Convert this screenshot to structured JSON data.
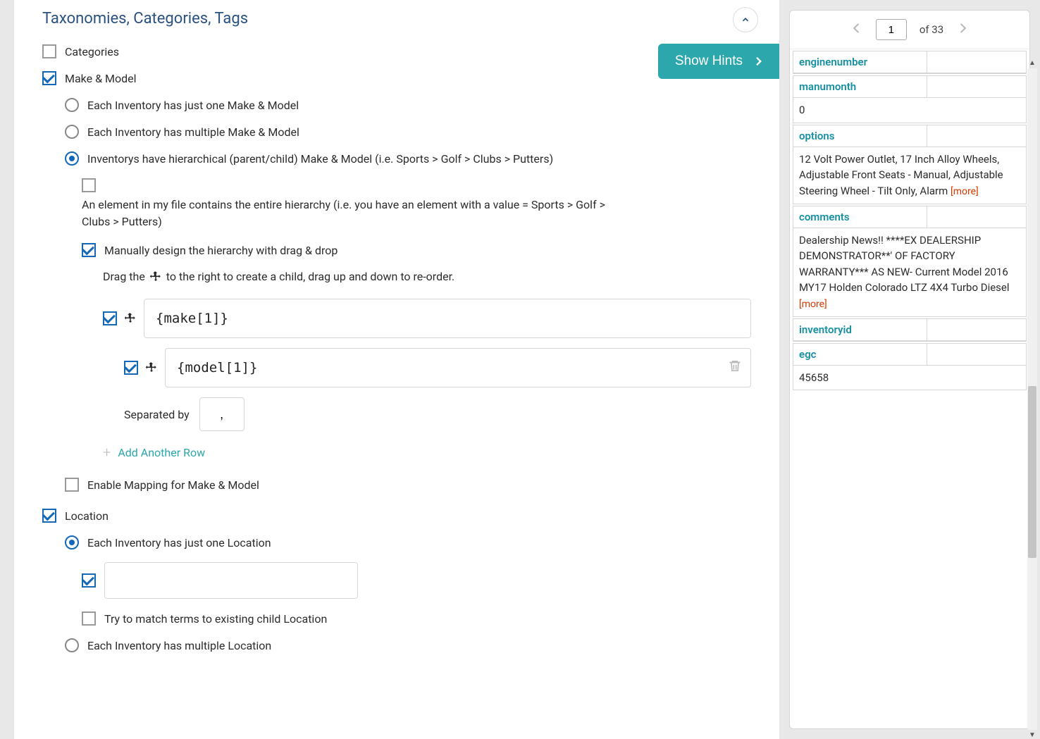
{
  "section": {
    "title": "Taxonomies, Categories, Tags"
  },
  "hints_button": "Show Hints",
  "taxonomies": {
    "categories": {
      "label": "Categories",
      "checked": false
    },
    "makeModel": {
      "label": "Make & Model",
      "checked": true,
      "options": {
        "single": "Each Inventory has just one Make & Model",
        "multiple": "Each Inventory has multiple Make & Model",
        "hierarchical": "Inventorys have hierarchical (parent/child) Make & Model (i.e. Sports > Golf > Clubs > Putters)"
      },
      "containsHierarchy": {
        "checked": false,
        "text": "An element in my file contains the entire hierarchy (i.e. you have an element with a value = Sports > Golf > Clubs > Putters)"
      },
      "manualDesign": {
        "checked": true,
        "label": "Manually design the hierarchy with drag & drop",
        "dragHelpBefore": "Drag the",
        "dragHelpAfter": "to the right to create a child, drag up and down to re-order.",
        "rows": [
          {
            "checked": true,
            "value": "{make[1]}"
          },
          {
            "checked": true,
            "value": "{model[1]}"
          }
        ],
        "separatorLabel": "Separated by",
        "separatorValue": ",",
        "addRow": "Add Another Row"
      },
      "enableMapping": {
        "checked": false,
        "label": "Enable Mapping for Make & Model"
      }
    },
    "location": {
      "label": "Location",
      "checked": true,
      "options": {
        "single": "Each Inventory has just one Location",
        "multiple": "Each Inventory has multiple Location"
      },
      "singleInput": {
        "checked": true,
        "value": ""
      },
      "tryMatch": {
        "checked": false,
        "label": "Try to match terms to existing child Location"
      }
    }
  },
  "pager": {
    "current": "1",
    "ofLabel": "of 33"
  },
  "fields": {
    "enginenumber": {
      "name": "enginenumber",
      "value": ""
    },
    "manumonth": {
      "name": "manumonth",
      "value": "0"
    },
    "options": {
      "name": "options",
      "value": "12 Volt Power Outlet, 17 Inch Alloy Wheels, Adjustable Front Seats - Manual, Adjustable Steering Wheel - Tilt Only, Alarm",
      "more": "[more]"
    },
    "comments": {
      "name": "comments",
      "value": "Dealership News!! ****EX DEALERSHIP DEMONSTRATOR**' OF FACTORY WARRANTY*** AS NEW- Current Model 2016 MY17 Holden Colorado LTZ 4X4 Turbo Diesel",
      "more": "[more]"
    },
    "inventoryid": {
      "name": "inventoryid",
      "value": ""
    },
    "egc": {
      "name": "egc",
      "value": "45658"
    }
  }
}
